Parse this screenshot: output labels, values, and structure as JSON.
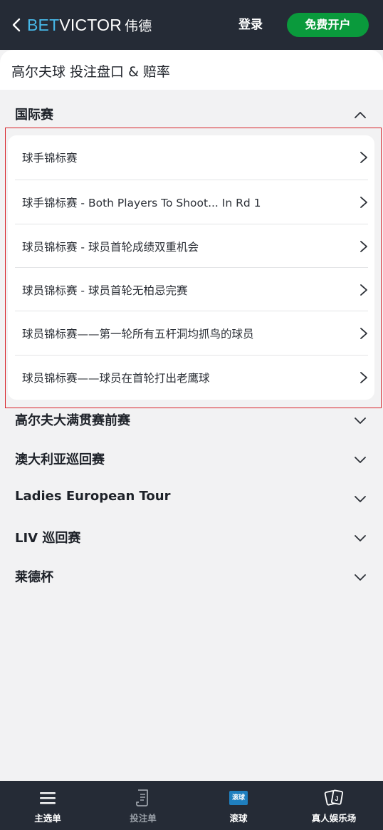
{
  "header": {
    "logo_bet": "BET",
    "logo_victor": "VICTOR",
    "logo_cn": "伟德",
    "login_label": "登录",
    "signup_label": "免费开户"
  },
  "page": {
    "title": "高尔夫球 投注盘口 & 赔率"
  },
  "sections": [
    {
      "label": "国际赛",
      "expanded": true
    },
    {
      "label": "高尔夫大满贯赛前赛",
      "expanded": false
    },
    {
      "label": "澳大利亚巡回赛",
      "expanded": false
    },
    {
      "label": "Ladies European Tour",
      "expanded": false
    },
    {
      "label": "LIV 巡回赛",
      "expanded": false
    },
    {
      "label": "莱德杯",
      "expanded": false
    }
  ],
  "markets": [
    {
      "label": "球手锦标赛"
    },
    {
      "label": "球手锦标赛 - Both Players To Shoot... In Rd 1"
    },
    {
      "label": "球员锦标赛 - 球员首轮成绩双重机会"
    },
    {
      "label": "球员锦标赛 - 球员首轮无柏忌完赛"
    },
    {
      "label": "球员锦标赛——第一轮所有五杆洞均抓鸟的球员"
    },
    {
      "label": "球员锦标赛——球员在首轮打出老鹰球"
    }
  ],
  "bottom_nav": {
    "items": [
      {
        "label": "主选单",
        "icon": "menu-icon"
      },
      {
        "label": "投注单",
        "icon": "betslip-icon"
      },
      {
        "label": "滚球",
        "icon": "live-icon",
        "badge": "滚球"
      },
      {
        "label": "真人娱乐场",
        "icon": "cards-icon"
      }
    ]
  },
  "colors": {
    "header_bg": "#252b36",
    "brand_blue": "#47b8e8",
    "signup_green": "#0a9a3c",
    "highlight_red": "#d8232a",
    "live_badge": "#1f7fbf"
  }
}
